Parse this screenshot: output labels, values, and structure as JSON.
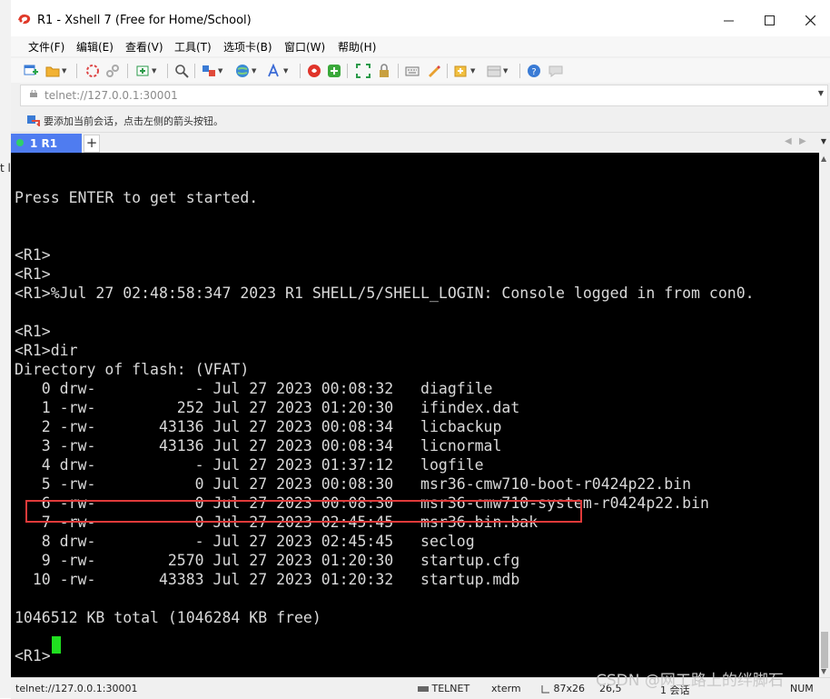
{
  "window": {
    "title": "R1 - Xshell 7 (Free for Home/School)"
  },
  "left_fragment": "t l",
  "menu": [
    "文件(F)",
    "编辑(E)",
    "查看(V)",
    "工具(T)",
    "选项卡(B)",
    "窗口(W)",
    "帮助(H)"
  ],
  "address": {
    "value": "telnet://127.0.0.1:30001"
  },
  "tip": {
    "text": "要添加当前会话，点击左侧的箭头按钮。"
  },
  "tabs": [
    {
      "label": "1 R1",
      "status_color": "#2fd06a"
    }
  ],
  "terminal": {
    "lines": [
      "",
      "Press ENTER to get started.",
      "",
      "",
      "<R1>",
      "<R1>",
      "<R1>%Jul 27 02:48:58:347 2023 R1 SHELL/5/SHELL_LOGIN: Console logged in from con0.",
      "",
      "<R1>",
      "<R1>dir",
      "Directory of flash: (VFAT)",
      "   0 drw-           - Jul 27 2023 00:08:32   diagfile",
      "   1 -rw-         252 Jul 27 2023 01:20:30   ifindex.dat",
      "   2 -rw-       43136 Jul 27 2023 00:08:34   licbackup",
      "   3 -rw-       43136 Jul 27 2023 00:08:34   licnormal",
      "   4 drw-           - Jul 27 2023 01:37:12   logfile",
      "   5 -rw-           0 Jul 27 2023 00:08:30   msr36-cmw710-boot-r0424p22.bin",
      "   6 -rw-           0 Jul 27 2023 00:08:30   msr36-cmw710-system-r0424p22.bin",
      "   7 -rw-           0 Jul 27 2023 02:45:45   msr36.bin.bak",
      "   8 drw-           - Jul 27 2023 02:45:45   seclog",
      "   9 -rw-        2570 Jul 27 2023 01:20:30   startup.cfg",
      "  10 -rw-       43383 Jul 27 2023 01:20:32   startup.mdb",
      "",
      "1046512 KB total (1046284 KB free)",
      "",
      "<R1>"
    ],
    "highlighted_line": "   7 -rw-           0 Jul 27 2023 02:45:45   msr36.bin.bak",
    "text_color": "#d9d9d9",
    "cursor_color": "#20e020",
    "highlight_color": "#e03a3a"
  },
  "status": {
    "connection": "telnet://127.0.0.1:30001",
    "protocol": "TELNET",
    "terminal_type": "xterm",
    "size": "87x26",
    "cursor_pos": "26,5",
    "sessions": "1 会话",
    "numlock": "NUM"
  },
  "watermark": "CSDN @网工路上的绊脚石"
}
